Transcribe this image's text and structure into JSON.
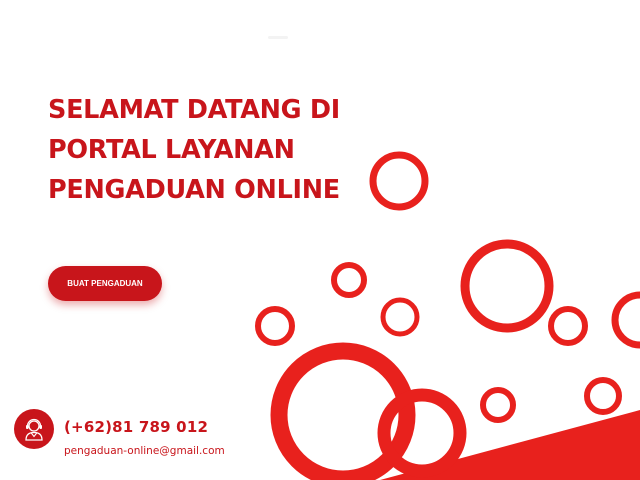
{
  "hero": {
    "title_line1": "SELAMAT DATANG DI",
    "title_line2": "PORTAL LAYANAN",
    "title_line3": "PENGADUAN ONLINE"
  },
  "cta": {
    "label": "BUAT PENGADUAN"
  },
  "contact": {
    "phone": "(+62)81 789 012",
    "email": "pengaduan-online@gmail.com",
    "icon": "customer-service-icon"
  },
  "colors": {
    "brand_red": "#c8151b",
    "ring_red": "#e8211d",
    "background": "#ffffff"
  }
}
